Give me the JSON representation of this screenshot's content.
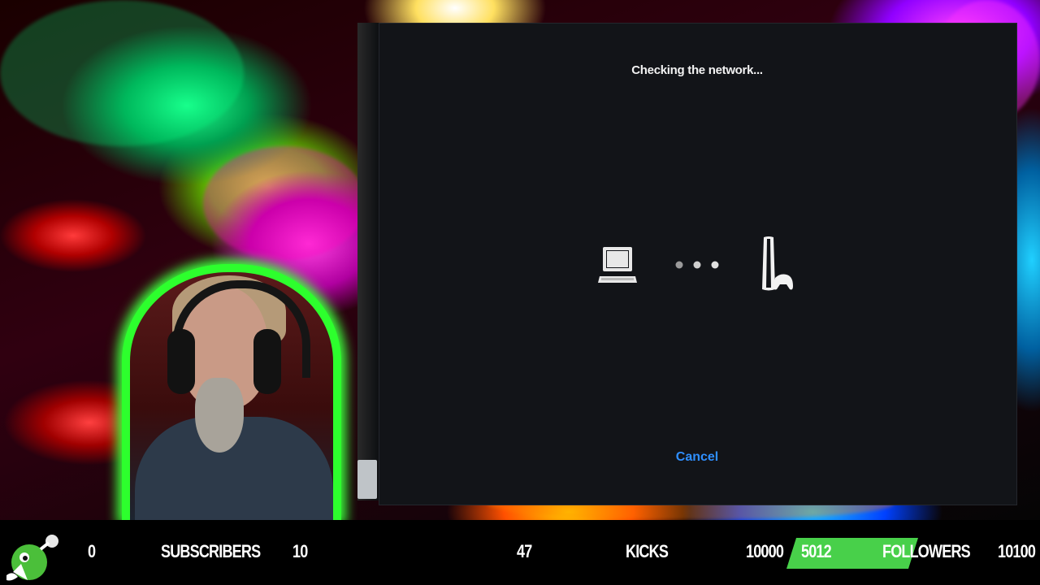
{
  "dialog": {
    "title": "Checking the network...",
    "cancel_label": "Cancel",
    "icons": [
      "pc-icon",
      "progress-dots-icon",
      "ps5-console-icon"
    ]
  },
  "stats": {
    "subscribers": {
      "current": "0",
      "label": "SUBSCRIBERS",
      "goal": "10"
    },
    "kicks": {
      "current": "47",
      "label": "KICKS",
      "goal": "10000"
    },
    "followers": {
      "current": "5012",
      "label": "FOLLOWERS",
      "goal": "10100"
    }
  },
  "colors": {
    "dialog_bg": "#121418",
    "accent_link": "#2f8fff",
    "goal_bar": "#48d04a",
    "webcam_border": "#2dff2d"
  }
}
